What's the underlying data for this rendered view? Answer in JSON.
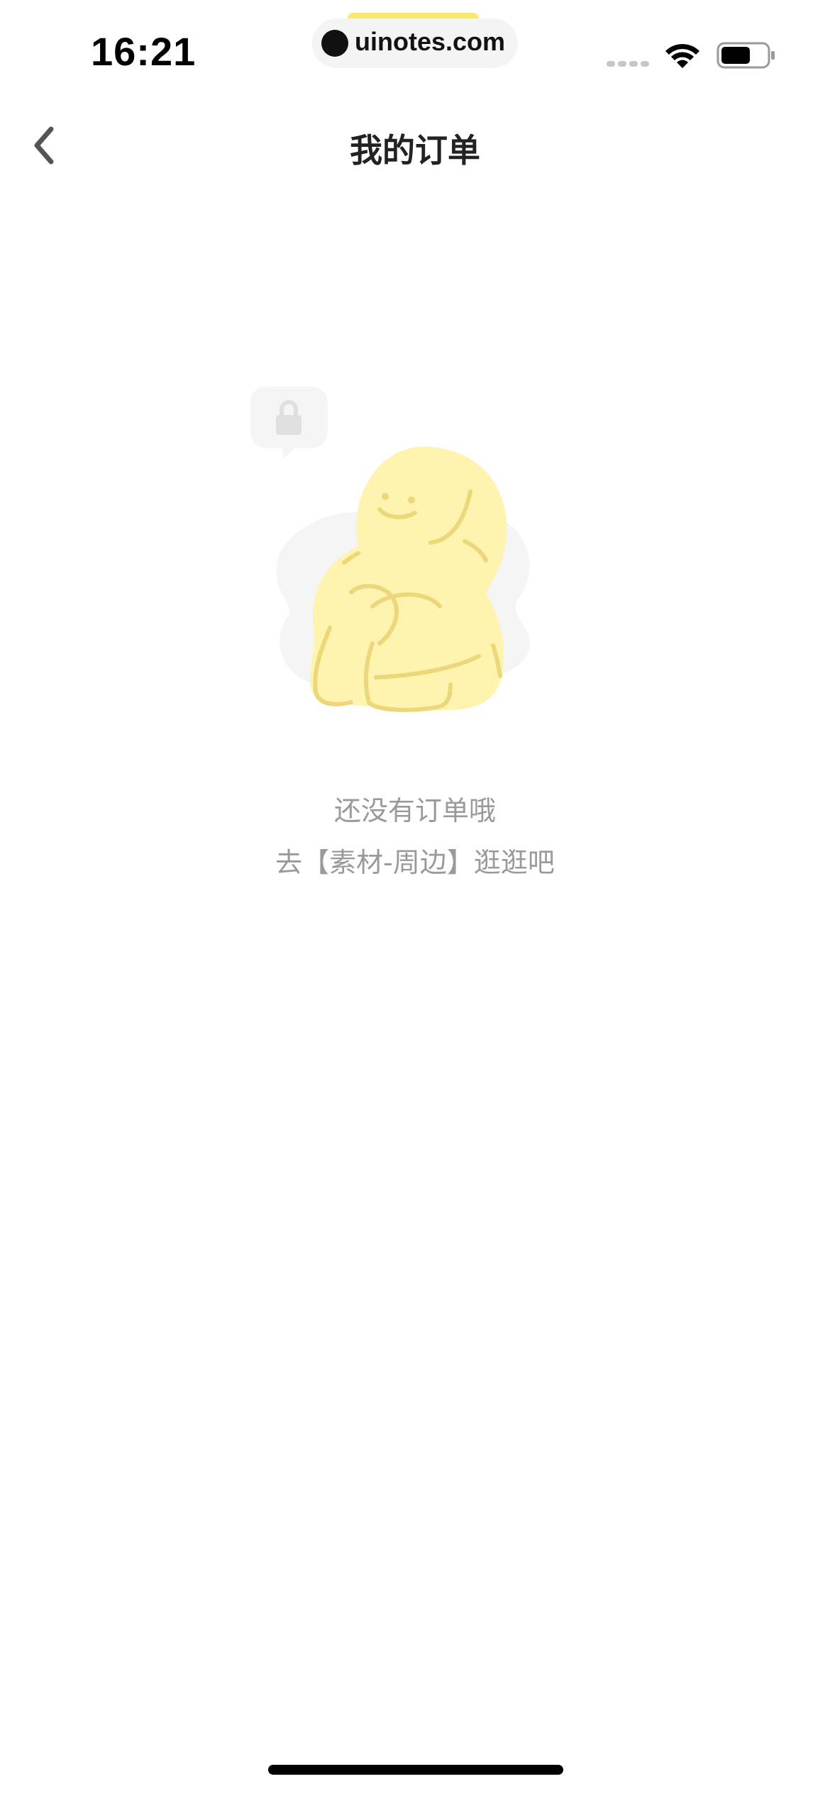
{
  "status_bar": {
    "time": "16:21",
    "watermark": "uinotes.com",
    "icons": [
      "signal-icon",
      "wifi-icon",
      "battery-icon"
    ]
  },
  "nav": {
    "title": "我的订单",
    "back_icon": "chevron-left-icon"
  },
  "empty_state": {
    "title": "还没有订单哦",
    "subtitle": "去【素材-周边】逛逛吧",
    "illustration": "yellow-character-hugging-knees-with-lock-bubble"
  },
  "colors": {
    "background": "#ffffff",
    "title_text": "#222222",
    "hint_text": "#9a9a9a",
    "character_fill": "#fff3b0",
    "character_line": "#ecd77a",
    "shadow_blob": "#f5f5f5"
  }
}
